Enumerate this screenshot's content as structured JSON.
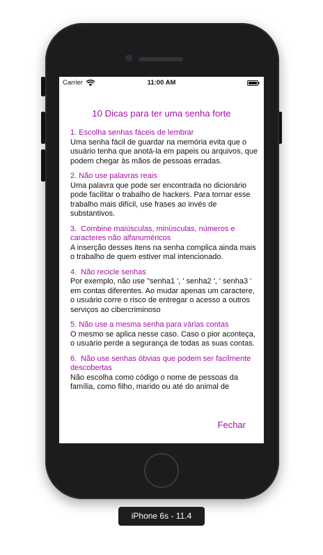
{
  "status_bar": {
    "carrier": "Carrier",
    "time": "11:00 AM"
  },
  "modal": {
    "title": "10 Dicas para ter uma senha forte",
    "tips": [
      {
        "heading": "1. Escolha senhas fáceis de lembrar",
        "body": "Uma senha fácil de guardar na memória evita que o usuário tenha que anotá-la em papeis ou arquivos, que podem chegar às mãos de pessoas erradas."
      },
      {
        "heading": "2. Não use palavras reais",
        "body": "Uma palavra que pode ser encontrada no dicionário pode facilitar o trabalho de hackers. Para tornar esse trabalho mais difícil, use frases ao invés de substantivos."
      },
      {
        "heading": "3.  Combine maiúsculas, minúsculas, números e caracteres não alfanuméricos",
        "body": "A inserção desses itens na senha complica ainda mais o trabalho de quem estiver mal intencionado."
      },
      {
        "heading": "4.  Não recicle senhas",
        "body": "Por exemplo, não use \"senha1 ', ' senha2 ', ' senha3 ' em contas diferentes. Ao mudar apenas um caractere, o usuário corre o risco de entregar o acesso a outros serviços ao cibercriminoso"
      },
      {
        "heading": "5. Não use a mesma senha para várias contas",
        "body": "O mesmo se aplica nesse caso. Caso o pior aconteça, o usuário perde a segurança de todas as suas contas."
      },
      {
        "heading": "6.  Não use senhas óbvias que podem ser facilmente descobertas",
        "body": "Não escolha como código o nome de pessoas da família, como filho, marido ou até do animal de"
      }
    ],
    "close_label": "Fechar"
  },
  "device_label": "iPhone 6s - 11.4",
  "colors": {
    "accent": "#a90ea9",
    "device": "#1c1c1e"
  },
  "icons": [
    "wifi-icon",
    "battery-icon"
  ]
}
